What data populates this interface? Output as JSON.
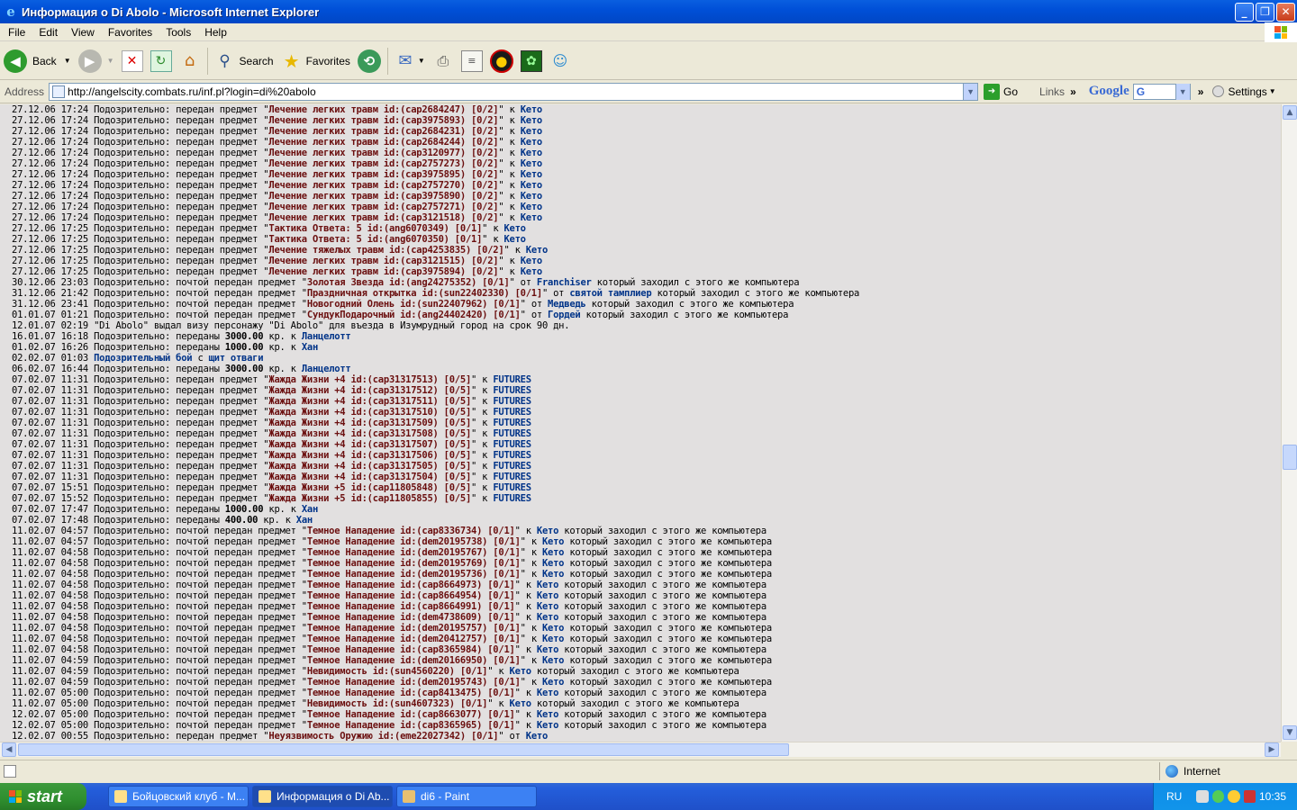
{
  "window": {
    "title": "Информация о Di Abolo - Microsoft Internet Explorer"
  },
  "menu": [
    "File",
    "Edit",
    "View",
    "Favorites",
    "Tools",
    "Help"
  ],
  "toolbar": {
    "back": "Back",
    "search": "Search",
    "favorites": "Favorites"
  },
  "address": {
    "label": "Address",
    "url": "http://angelscity.combats.ru/inf.pl?login=di%20abolo",
    "go": "Go",
    "links": "Links",
    "google": "Google",
    "settings": "Settings"
  },
  "log": [
    [
      [
        "t",
        "27.12.06 17:24 Подозрительно: передан предмет \""
      ],
      [
        "i",
        "Лечение легких травм id:(cap2684247) [0/2]"
      ],
      [
        "t",
        "\" к "
      ],
      [
        "n",
        "Кето"
      ]
    ],
    [
      [
        "t",
        "27.12.06 17:24 Подозрительно: передан предмет \""
      ],
      [
        "i",
        "Лечение легких травм id:(cap3975893) [0/2]"
      ],
      [
        "t",
        "\" к "
      ],
      [
        "n",
        "Кето"
      ]
    ],
    [
      [
        "t",
        "27.12.06 17:24 Подозрительно: передан предмет \""
      ],
      [
        "i",
        "Лечение легких травм id:(cap2684231) [0/2]"
      ],
      [
        "t",
        "\" к "
      ],
      [
        "n",
        "Кето"
      ]
    ],
    [
      [
        "t",
        "27.12.06 17:24 Подозрительно: передан предмет \""
      ],
      [
        "i",
        "Лечение легких травм id:(cap2684244) [0/2]"
      ],
      [
        "t",
        "\" к "
      ],
      [
        "n",
        "Кето"
      ]
    ],
    [
      [
        "t",
        "27.12.06 17:24 Подозрительно: передан предмет \""
      ],
      [
        "i",
        "Лечение легких травм id:(cap3120977) [0/2]"
      ],
      [
        "t",
        "\" к "
      ],
      [
        "n",
        "Кето"
      ]
    ],
    [
      [
        "t",
        "27.12.06 17:24 Подозрительно: передан предмет \""
      ],
      [
        "i",
        "Лечение легких травм id:(cap2757273) [0/2]"
      ],
      [
        "t",
        "\" к "
      ],
      [
        "n",
        "Кето"
      ]
    ],
    [
      [
        "t",
        "27.12.06 17:24 Подозрительно: передан предмет \""
      ],
      [
        "i",
        "Лечение легких травм id:(cap3975895) [0/2]"
      ],
      [
        "t",
        "\" к "
      ],
      [
        "n",
        "Кето"
      ]
    ],
    [
      [
        "t",
        "27.12.06 17:24 Подозрительно: передан предмет \""
      ],
      [
        "i",
        "Лечение легких травм id:(cap2757270) [0/2]"
      ],
      [
        "t",
        "\" к "
      ],
      [
        "n",
        "Кето"
      ]
    ],
    [
      [
        "t",
        "27.12.06 17:24 Подозрительно: передан предмет \""
      ],
      [
        "i",
        "Лечение легких травм id:(cap3975890) [0/2]"
      ],
      [
        "t",
        "\" к "
      ],
      [
        "n",
        "Кето"
      ]
    ],
    [
      [
        "t",
        "27.12.06 17:24 Подозрительно: передан предмет \""
      ],
      [
        "i",
        "Лечение легких травм id:(cap2757271) [0/2]"
      ],
      [
        "t",
        "\" к "
      ],
      [
        "n",
        "Кето"
      ]
    ],
    [
      [
        "t",
        "27.12.06 17:24 Подозрительно: передан предмет \""
      ],
      [
        "i",
        "Лечение легких травм id:(cap3121518) [0/2]"
      ],
      [
        "t",
        "\" к "
      ],
      [
        "n",
        "Кето"
      ]
    ],
    [
      [
        "t",
        "27.12.06 17:25 Подозрительно: передан предмет \""
      ],
      [
        "i",
        "Тактика Ответа: 5 id:(ang6070349) [0/1]"
      ],
      [
        "t",
        "\" к "
      ],
      [
        "n",
        "Кето"
      ]
    ],
    [
      [
        "t",
        "27.12.06 17:25 Подозрительно: передан предмет \""
      ],
      [
        "i",
        "Тактика Ответа: 5 id:(ang6070350) [0/1]"
      ],
      [
        "t",
        "\" к "
      ],
      [
        "n",
        "Кето"
      ]
    ],
    [
      [
        "t",
        "27.12.06 17:25 Подозрительно: передан предмет \""
      ],
      [
        "i",
        "Лечение тяжелых травм id:(cap4253835) [0/2]"
      ],
      [
        "t",
        "\" к "
      ],
      [
        "n",
        "Кето"
      ]
    ],
    [
      [
        "t",
        "27.12.06 17:25 Подозрительно: передан предмет \""
      ],
      [
        "i",
        "Лечение легких травм id:(cap3121515) [0/2]"
      ],
      [
        "t",
        "\" к "
      ],
      [
        "n",
        "Кето"
      ]
    ],
    [
      [
        "t",
        "27.12.06 17:25 Подозрительно: передан предмет \""
      ],
      [
        "i",
        "Лечение легких травм id:(cap3975894) [0/2]"
      ],
      [
        "t",
        "\" к "
      ],
      [
        "n",
        "Кето"
      ]
    ],
    [
      [
        "t",
        "30.12.06 23:03 Подозрительно: почтой передан предмет \""
      ],
      [
        "i",
        "Золотая Звезда id:(ang24275352) [0/1]"
      ],
      [
        "t",
        "\" от "
      ],
      [
        "n",
        "Franchiser"
      ],
      [
        "t",
        " который заходил с этого же компьютера"
      ]
    ],
    [
      [
        "t",
        "31.12.06 21:42 Подозрительно: почтой передан предмет \""
      ],
      [
        "i",
        "Праздничная открытка id:(sun22402330) [0/1]"
      ],
      [
        "t",
        "\" от "
      ],
      [
        "n",
        "святой тамплиер"
      ],
      [
        "t",
        " который заходил с этого же компьютера"
      ]
    ],
    [
      [
        "t",
        "31.12.06 23:41 Подозрительно: почтой передан предмет \""
      ],
      [
        "i",
        "Новогодний Олень id:(sun22407962) [0/1]"
      ],
      [
        "t",
        "\" от "
      ],
      [
        "n",
        "Медведь"
      ],
      [
        "t",
        " который заходил с этого же компьютера"
      ]
    ],
    [
      [
        "t",
        "01.01.07 01:21 Подозрительно: почтой передан предмет \""
      ],
      [
        "i",
        "СундукПодарочный id:(ang24402420) [0/1]"
      ],
      [
        "t",
        "\" от "
      ],
      [
        "n",
        "Гордей"
      ],
      [
        "t",
        " который заходил с этого же компьютера"
      ]
    ],
    [
      [
        "t",
        "12.01.07 02:19 \"Di Abolo\" выдал визу персонажу \"Di Abolo\" для въезда в Изумрудный город на срок 90 дн."
      ]
    ],
    [
      [
        "t",
        "16.01.07 16:18 Подозрительно: переданы "
      ],
      [
        "b",
        "3000.00"
      ],
      [
        "t",
        " кр. к "
      ],
      [
        "n",
        "Ланцелотт"
      ]
    ],
    [
      [
        "t",
        "01.02.07 16:26 Подозрительно: переданы "
      ],
      [
        "b",
        "1000.00"
      ],
      [
        "t",
        " кр. к "
      ],
      [
        "n",
        "Хан"
      ]
    ],
    [
      [
        "t",
        "02.02.07 01:03 "
      ],
      [
        "n",
        "Подозрительный бой"
      ],
      [
        "t",
        " с "
      ],
      [
        "n",
        "щит отваги"
      ]
    ],
    [
      [
        "t",
        "06.02.07 16:44 Подозрительно: переданы "
      ],
      [
        "b",
        "3000.00"
      ],
      [
        "t",
        " кр. к "
      ],
      [
        "n",
        "Ланцелотт"
      ]
    ],
    [
      [
        "t",
        "07.02.07 11:31 Подозрительно: передан предмет \""
      ],
      [
        "i",
        "Жажда Жизни +4 id:(cap31317513) [0/5]"
      ],
      [
        "t",
        "\" к "
      ],
      [
        "n",
        "FUTURES"
      ]
    ],
    [
      [
        "t",
        "07.02.07 11:31 Подозрительно: передан предмет \""
      ],
      [
        "i",
        "Жажда Жизни +4 id:(cap31317512) [0/5]"
      ],
      [
        "t",
        "\" к "
      ],
      [
        "n",
        "FUTURES"
      ]
    ],
    [
      [
        "t",
        "07.02.07 11:31 Подозрительно: передан предмет \""
      ],
      [
        "i",
        "Жажда Жизни +4 id:(cap31317511) [0/5]"
      ],
      [
        "t",
        "\" к "
      ],
      [
        "n",
        "FUTURES"
      ]
    ],
    [
      [
        "t",
        "07.02.07 11:31 Подозрительно: передан предмет \""
      ],
      [
        "i",
        "Жажда Жизни +4 id:(cap31317510) [0/5]"
      ],
      [
        "t",
        "\" к "
      ],
      [
        "n",
        "FUTURES"
      ]
    ],
    [
      [
        "t",
        "07.02.07 11:31 Подозрительно: передан предмет \""
      ],
      [
        "i",
        "Жажда Жизни +4 id:(cap31317509) [0/5]"
      ],
      [
        "t",
        "\" к "
      ],
      [
        "n",
        "FUTURES"
      ]
    ],
    [
      [
        "t",
        "07.02.07 11:31 Подозрительно: передан предмет \""
      ],
      [
        "i",
        "Жажда Жизни +4 id:(cap31317508) [0/5]"
      ],
      [
        "t",
        "\" к "
      ],
      [
        "n",
        "FUTURES"
      ]
    ],
    [
      [
        "t",
        "07.02.07 11:31 Подозрительно: передан предмет \""
      ],
      [
        "i",
        "Жажда Жизни +4 id:(cap31317507) [0/5]"
      ],
      [
        "t",
        "\" к "
      ],
      [
        "n",
        "FUTURES"
      ]
    ],
    [
      [
        "t",
        "07.02.07 11:31 Подозрительно: передан предмет \""
      ],
      [
        "i",
        "Жажда Жизни +4 id:(cap31317506) [0/5]"
      ],
      [
        "t",
        "\" к "
      ],
      [
        "n",
        "FUTURES"
      ]
    ],
    [
      [
        "t",
        "07.02.07 11:31 Подозрительно: передан предмет \""
      ],
      [
        "i",
        "Жажда Жизни +4 id:(cap31317505) [0/5]"
      ],
      [
        "t",
        "\" к "
      ],
      [
        "n",
        "FUTURES"
      ]
    ],
    [
      [
        "t",
        "07.02.07 11:31 Подозрительно: передан предмет \""
      ],
      [
        "i",
        "Жажда Жизни +4 id:(cap31317504) [0/5]"
      ],
      [
        "t",
        "\" к "
      ],
      [
        "n",
        "FUTURES"
      ]
    ],
    [
      [
        "t",
        "07.02.07 15:51 Подозрительно: передан предмет \""
      ],
      [
        "i",
        "Жажда Жизни +5 id:(cap11805848) [0/5]"
      ],
      [
        "t",
        "\" к "
      ],
      [
        "n",
        "FUTURES"
      ]
    ],
    [
      [
        "t",
        "07.02.07 15:52 Подозрительно: передан предмет \""
      ],
      [
        "i",
        "Жажда Жизни +5 id:(cap11805855) [0/5]"
      ],
      [
        "t",
        "\" к "
      ],
      [
        "n",
        "FUTURES"
      ]
    ],
    [
      [
        "t",
        "07.02.07 17:47 Подозрительно: переданы "
      ],
      [
        "b",
        "1000.00"
      ],
      [
        "t",
        " кр. к "
      ],
      [
        "n",
        "Хан"
      ]
    ],
    [
      [
        "t",
        "07.02.07 17:48 Подозрительно: переданы "
      ],
      [
        "b",
        "400.00"
      ],
      [
        "t",
        " кр. к "
      ],
      [
        "n",
        "Хан"
      ]
    ],
    [
      [
        "t",
        "11.02.07 04:57 Подозрительно: почтой передан предмет \""
      ],
      [
        "i",
        "Темное Нападение id:(cap8336734) [0/1]"
      ],
      [
        "t",
        "\" к "
      ],
      [
        "n",
        "Кето"
      ],
      [
        "t",
        " который заходил с этого же компьютера"
      ]
    ],
    [
      [
        "t",
        "11.02.07 04:57 Подозрительно: почтой передан предмет \""
      ],
      [
        "i",
        "Темное Нападение id:(dem20195738) [0/1]"
      ],
      [
        "t",
        "\" к "
      ],
      [
        "n",
        "Кето"
      ],
      [
        "t",
        " который заходил с этого же компьютера"
      ]
    ],
    [
      [
        "t",
        "11.02.07 04:58 Подозрительно: почтой передан предмет \""
      ],
      [
        "i",
        "Темное Нападение id:(dem20195767) [0/1]"
      ],
      [
        "t",
        "\" к "
      ],
      [
        "n",
        "Кето"
      ],
      [
        "t",
        " который заходил с этого же компьютера"
      ]
    ],
    [
      [
        "t",
        "11.02.07 04:58 Подозрительно: почтой передан предмет \""
      ],
      [
        "i",
        "Темное Нападение id:(dem20195769) [0/1]"
      ],
      [
        "t",
        "\" к "
      ],
      [
        "n",
        "Кето"
      ],
      [
        "t",
        " который заходил с этого же компьютера"
      ]
    ],
    [
      [
        "t",
        "11.02.07 04:58 Подозрительно: почтой передан предмет \""
      ],
      [
        "i",
        "Темное Нападение id:(dem20195736) [0/1]"
      ],
      [
        "t",
        "\" к "
      ],
      [
        "n",
        "Кето"
      ],
      [
        "t",
        " который заходил с этого же компьютера"
      ]
    ],
    [
      [
        "t",
        "11.02.07 04:58 Подозрительно: почтой передан предмет \""
      ],
      [
        "i",
        "Темное Нападение id:(cap8664973) [0/1]"
      ],
      [
        "t",
        "\" к "
      ],
      [
        "n",
        "Кето"
      ],
      [
        "t",
        " который заходил с этого же компьютера"
      ]
    ],
    [
      [
        "t",
        "11.02.07 04:58 Подозрительно: почтой передан предмет \""
      ],
      [
        "i",
        "Темное Нападение id:(cap8664954) [0/1]"
      ],
      [
        "t",
        "\" к "
      ],
      [
        "n",
        "Кето"
      ],
      [
        "t",
        " который заходил с этого же компьютера"
      ]
    ],
    [
      [
        "t",
        "11.02.07 04:58 Подозрительно: почтой передан предмет \""
      ],
      [
        "i",
        "Темное Нападение id:(cap8664991) [0/1]"
      ],
      [
        "t",
        "\" к "
      ],
      [
        "n",
        "Кето"
      ],
      [
        "t",
        " который заходил с этого же компьютера"
      ]
    ],
    [
      [
        "t",
        "11.02.07 04:58 Подозрительно: почтой передан предмет \""
      ],
      [
        "i",
        "Темное Нападение id:(dem4738609) [0/1]"
      ],
      [
        "t",
        "\" к "
      ],
      [
        "n",
        "Кето"
      ],
      [
        "t",
        " который заходил с этого же компьютера"
      ]
    ],
    [
      [
        "t",
        "11.02.07 04:58 Подозрительно: почтой передан предмет \""
      ],
      [
        "i",
        "Темное Нападение id:(dem20195757) [0/1]"
      ],
      [
        "t",
        "\" к "
      ],
      [
        "n",
        "Кето"
      ],
      [
        "t",
        " который заходил с этого же компьютера"
      ]
    ],
    [
      [
        "t",
        "11.02.07 04:58 Подозрительно: почтой передан предмет \""
      ],
      [
        "i",
        "Темное Нападение id:(dem20412757) [0/1]"
      ],
      [
        "t",
        "\" к "
      ],
      [
        "n",
        "Кето"
      ],
      [
        "t",
        " который заходил с этого же компьютера"
      ]
    ],
    [
      [
        "t",
        "11.02.07 04:58 Подозрительно: почтой передан предмет \""
      ],
      [
        "i",
        "Темное Нападение id:(cap8365984) [0/1]"
      ],
      [
        "t",
        "\" к "
      ],
      [
        "n",
        "Кето"
      ],
      [
        "t",
        " который заходил с этого же компьютера"
      ]
    ],
    [
      [
        "t",
        "11.02.07 04:59 Подозрительно: почтой передан предмет \""
      ],
      [
        "i",
        "Темное Нападение id:(dem20166950) [0/1]"
      ],
      [
        "t",
        "\" к "
      ],
      [
        "n",
        "Кето"
      ],
      [
        "t",
        " который заходил с этого же компьютера"
      ]
    ],
    [
      [
        "t",
        "11.02.07 04:59 Подозрительно: почтой передан предмет \""
      ],
      [
        "i",
        "Невидимость id:(sun4560220) [0/1]"
      ],
      [
        "t",
        "\" к "
      ],
      [
        "n",
        "Кето"
      ],
      [
        "t",
        " который заходил с этого же компьютера"
      ]
    ],
    [
      [
        "t",
        "11.02.07 04:59 Подозрительно: почтой передан предмет \""
      ],
      [
        "i",
        "Темное Нападение id:(dem20195743) [0/1]"
      ],
      [
        "t",
        "\" к "
      ],
      [
        "n",
        "Кето"
      ],
      [
        "t",
        " который заходил с этого же компьютера"
      ]
    ],
    [
      [
        "t",
        "11.02.07 05:00 Подозрительно: почтой передан предмет \""
      ],
      [
        "i",
        "Темное Нападение id:(cap8413475) [0/1]"
      ],
      [
        "t",
        "\" к "
      ],
      [
        "n",
        "Кето"
      ],
      [
        "t",
        " который заходил с этого же компьютера"
      ]
    ],
    [
      [
        "t",
        "11.02.07 05:00 Подозрительно: почтой передан предмет \""
      ],
      [
        "i",
        "Невидимость id:(sun4607323) [0/1]"
      ],
      [
        "t",
        "\" к "
      ],
      [
        "n",
        "Кето"
      ],
      [
        "t",
        " который заходил с этого же компьютера"
      ]
    ],
    [
      [
        "t",
        "12.02.07 05:00 Подозрительно: почтой передан предмет \""
      ],
      [
        "i",
        "Темное Нападение id:(cap8663077) [0/1]"
      ],
      [
        "t",
        "\" к "
      ],
      [
        "n",
        "Кето"
      ],
      [
        "t",
        " который заходил с этого же компьютера"
      ]
    ],
    [
      [
        "t",
        "12.02.07 05:00 Подозрительно: почтой передан предмет \""
      ],
      [
        "i",
        "Темное Нападение id:(cap8365965) [0/1]"
      ],
      [
        "t",
        "\" к "
      ],
      [
        "n",
        "Кето"
      ],
      [
        "t",
        " который заходил с этого же компьютера"
      ]
    ],
    [
      [
        "t",
        "12.02.07 00:55 Подозрительно: передан предмет \""
      ],
      [
        "i",
        "Неуязвимость Оружию id:(eme22027342) [0/1]"
      ],
      [
        "t",
        "\" от "
      ],
      [
        "n",
        "Кето"
      ]
    ]
  ],
  "status": {
    "zone": "Internet"
  },
  "taskbar": {
    "start": "start",
    "tasks": [
      "Бойцовский клуб - М...",
      "Информация о Di Ab...",
      "di6 - Paint"
    ],
    "lang": "RU",
    "clock": "10:35"
  }
}
